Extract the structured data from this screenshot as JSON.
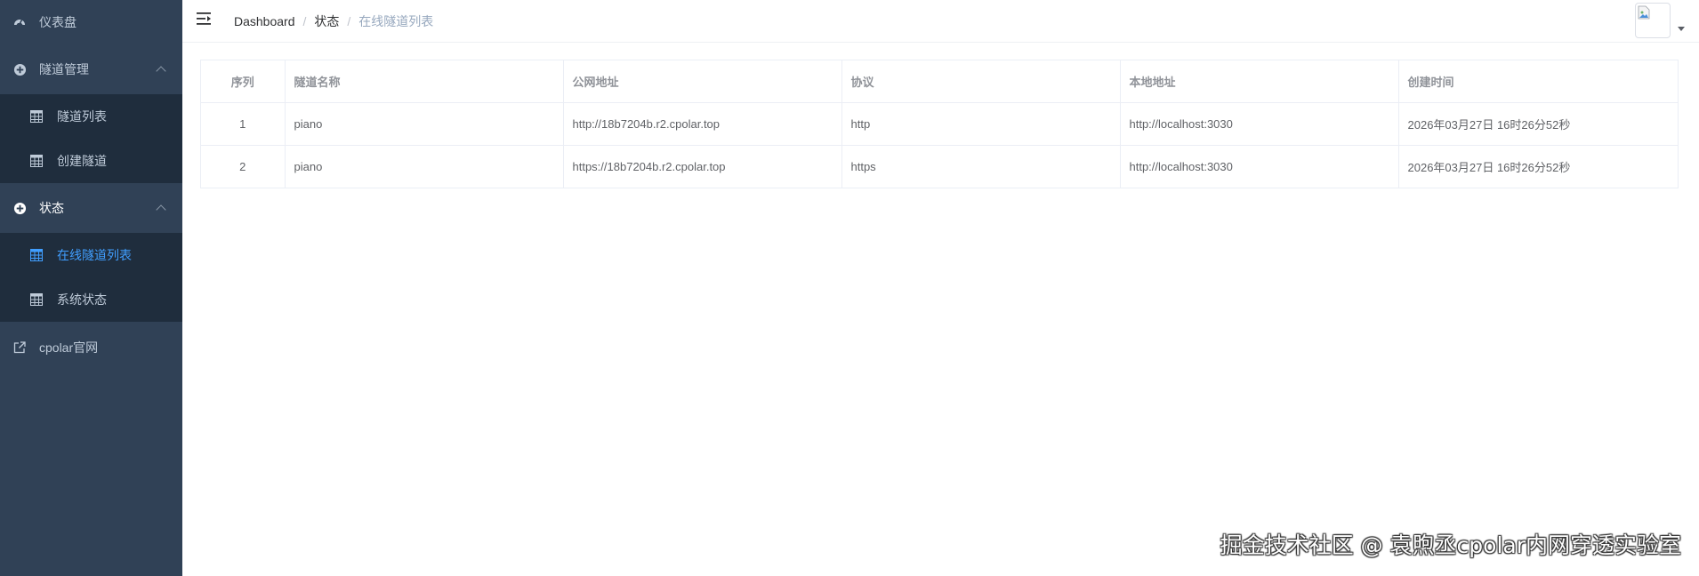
{
  "sidebar": {
    "dashboard": {
      "label": "仪表盘",
      "icon": "dashboard-icon"
    },
    "tunnel_mgmt": {
      "label": "隧道管理",
      "icon": "plus-circle-icon",
      "items": [
        {
          "label": "隧道列表"
        },
        {
          "label": "创建隧道"
        }
      ]
    },
    "status": {
      "label": "状态",
      "icon": "plus-circle-icon",
      "items": [
        {
          "label": "在线隧道列表",
          "active": true
        },
        {
          "label": "系统状态"
        }
      ]
    },
    "website": {
      "label": "cpolar官网",
      "icon": "external-link-icon"
    }
  },
  "header": {
    "breadcrumb": [
      "Dashboard",
      "状态",
      "在线隧道列表"
    ]
  },
  "table": {
    "columns": [
      "序列",
      "隧道名称",
      "公网地址",
      "协议",
      "本地地址",
      "创建时间"
    ],
    "rows": [
      [
        "1",
        "piano",
        "http://18b7204b.r2.cpolar.top",
        "http",
        "http://localhost:3030",
        "2026年03月27日 16时26分52秒"
      ],
      [
        "2",
        "piano",
        "https://18b7204b.r2.cpolar.top",
        "https",
        "http://localhost:3030",
        "2026年03月27日 16时26分52秒"
      ]
    ]
  },
  "watermark": "掘金技术社区 @ 袁煦丞cpolar内网穿透实验室",
  "colors": {
    "sidebar_bg": "#304156",
    "submenu_bg": "#1f2d3d",
    "active": "#409eff",
    "menu_text": "#bfcbd9"
  }
}
